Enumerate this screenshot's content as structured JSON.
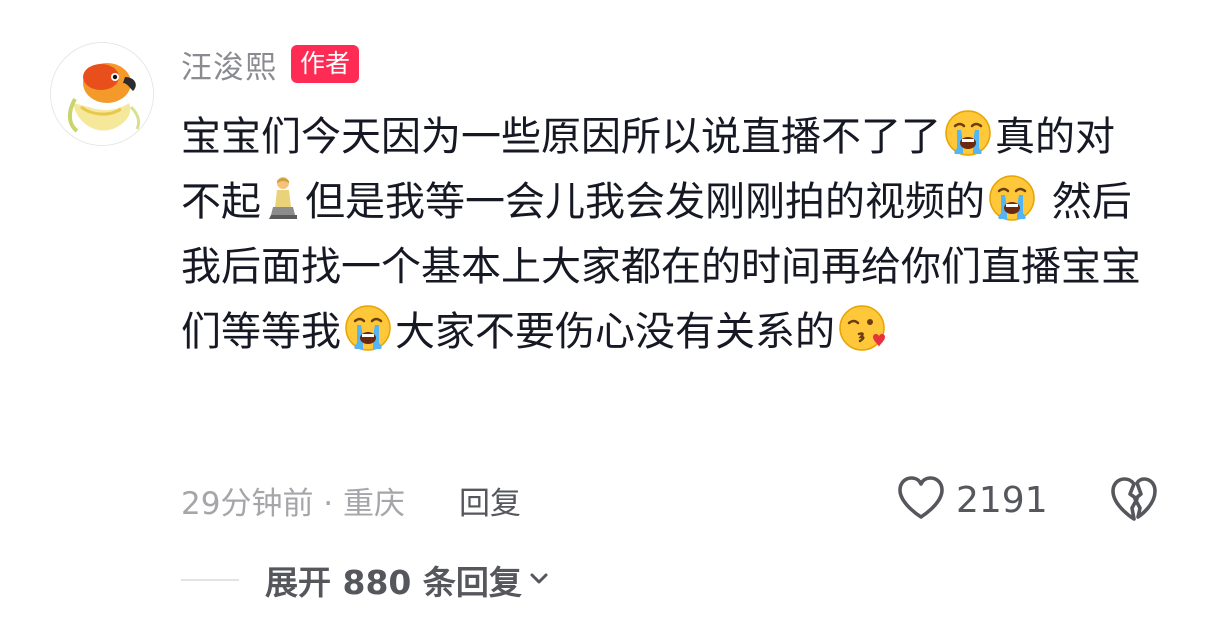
{
  "comment": {
    "author_name": "汪浚熙",
    "author_badge": "作者",
    "avatar_icon": "parrot-avatar",
    "text_segments": [
      "宝宝们今天因为一些原因所以说直播不了了",
      "真的对不起",
      "但是我等一会儿我会发刚刚拍的视频的",
      " 然后我后面找一个基本上大家都在的时间再给你们直播宝宝们等等我",
      "大家不要伤心没有关系的"
    ],
    "emojis": [
      "crying-face-emoji",
      "kneeling-person-emoji",
      "crying-face-emoji",
      "crying-face-emoji",
      "kissing-face-emoji"
    ],
    "time_location": "29分钟前 · 重庆",
    "reply_label": "回复",
    "like_count": "2191",
    "like_icon": "heart-outline-icon",
    "dislike_icon": "broken-heart-icon",
    "expand_replies_label": "展开 880 条回复",
    "expand_icon": "chevron-down-icon"
  },
  "colors": {
    "badge_bg": "#fe2c55",
    "username": "#8a8b91",
    "text": "#161823",
    "meta": "#a5a6aa",
    "action": "#55575c"
  }
}
